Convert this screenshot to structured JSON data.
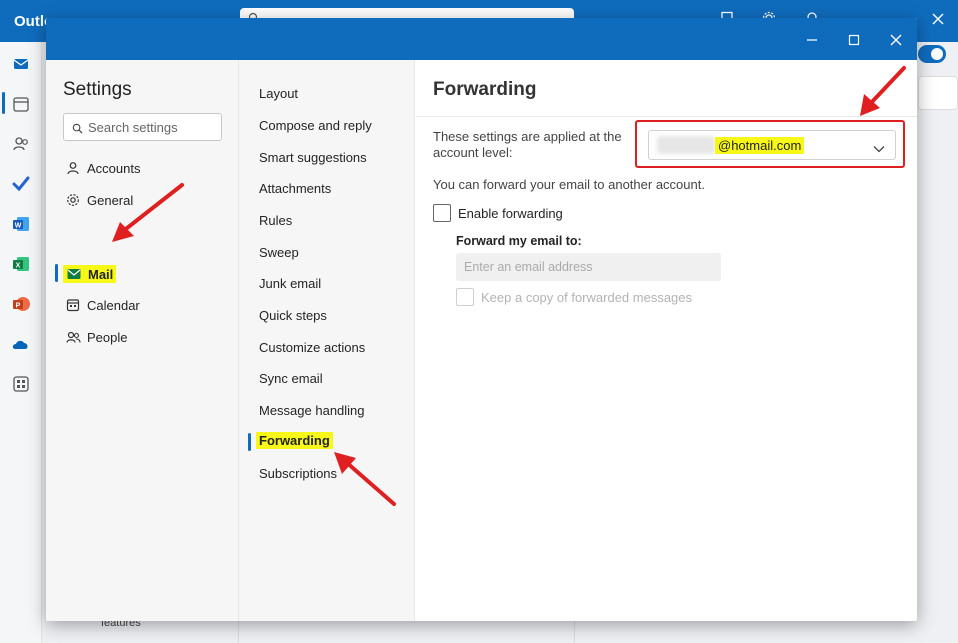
{
  "app": {
    "title": "Outlo",
    "search_placeholder": "Search",
    "behind_text": "features"
  },
  "dialog": {
    "settings_title": "Settings",
    "search_placeholder": "Search settings",
    "categories": [
      {
        "label": "Accounts",
        "icon": "person-icon"
      },
      {
        "label": "General",
        "icon": "gear-icon"
      },
      {
        "label": "Mail",
        "icon": "mail-icon",
        "selected": true
      },
      {
        "label": "Calendar",
        "icon": "calendar-icon"
      },
      {
        "label": "People",
        "icon": "people-icon"
      }
    ],
    "mail_sections": [
      "Layout",
      "Compose and reply",
      "Smart suggestions",
      "Attachments",
      "Rules",
      "Sweep",
      "Junk email",
      "Quick steps",
      "Customize actions",
      "Sync email",
      "Message handling",
      "Forwarding",
      "Subscriptions"
    ],
    "selected_section": "Forwarding"
  },
  "forwarding": {
    "title": "Forwarding",
    "applied_text": "These settings are applied at the account level:",
    "account_domain": "@hotmail.com",
    "description": "You can forward your email to another account.",
    "enable_label": "Enable forwarding",
    "enable_checked": false,
    "forward_to_label": "Forward my email to:",
    "email_placeholder": "Enter an email address",
    "keep_copy_label": "Keep a copy of forwarded messages",
    "keep_copy_checked": false
  },
  "colors": {
    "brand": "#0f6cbd",
    "highlight": "#f7f718",
    "annotation": "#e02020"
  }
}
